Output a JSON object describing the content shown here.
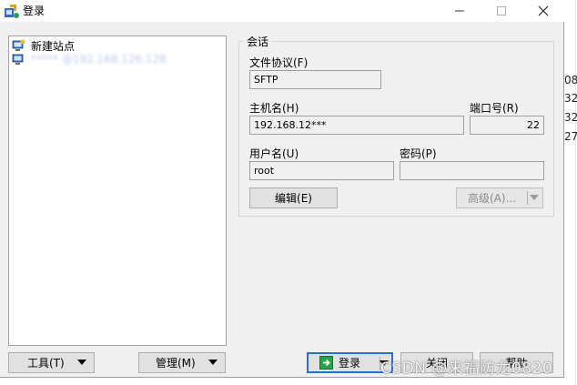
{
  "window": {
    "title": "登录"
  },
  "tree": {
    "items": [
      {
        "label": "新建站点"
      },
      {
        "label": "***** @192.168.126.128"
      }
    ]
  },
  "session": {
    "legend": "会话",
    "protocol_label": "文件协议(F)",
    "protocol_value": "SFTP",
    "host_label": "主机名(H)",
    "host_value": "192.168.12***",
    "port_label": "端口号(R)",
    "port_value": "22",
    "user_label": "用户名(U)",
    "user_value": "root",
    "password_label": "密码(P)",
    "password_value": "",
    "edit_label": "编辑(E)",
    "advanced_label": "高级(A)..."
  },
  "bottom": {
    "tools_label": "工具(T)",
    "manage_label": "管理(M)",
    "login_label": "登录",
    "close_label": "关闭",
    "help_label": "帮助"
  },
  "background_numbers": [
    "08",
    "32",
    "32",
    "27"
  ],
  "watermark": "CSDN @来福防龙0820",
  "colors": {
    "accent": "#2670d4",
    "dialog_bg": "#f0f0f0"
  }
}
